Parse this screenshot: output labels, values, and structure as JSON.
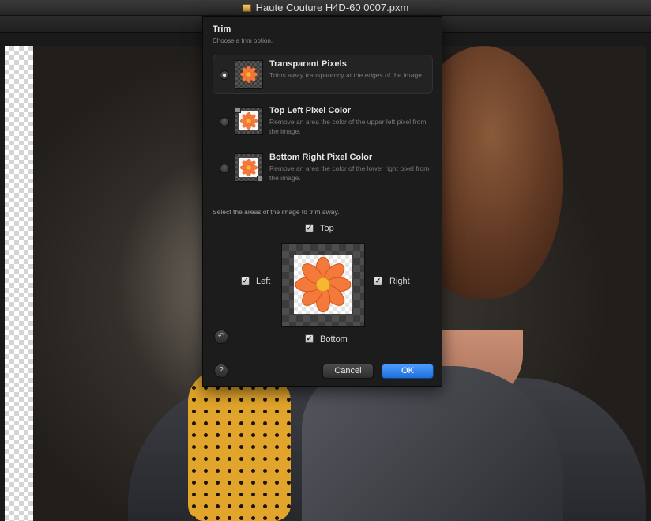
{
  "window": {
    "title": "Haute Couture H4D-60 0007.pxm"
  },
  "dialog": {
    "title": "Trim",
    "subtitle": "Choose a trim option.",
    "options": [
      {
        "title": "Transparent Pixels",
        "description": "Trims away transparency at the edges of the image.",
        "selected": true
      },
      {
        "title": "Top Left Pixel Color",
        "description": "Remove an area the color of the upper left pixel from the image.",
        "selected": false
      },
      {
        "title": "Bottom Right Pixel Color",
        "description": "Remove an area the color of the lower right pixel from the image.",
        "selected": false
      }
    ],
    "areas_label": "Select the areas of the image to trim away.",
    "areas": {
      "top": {
        "label": "Top",
        "checked": true
      },
      "left": {
        "label": "Left",
        "checked": true
      },
      "right": {
        "label": "Right",
        "checked": true
      },
      "bottom": {
        "label": "Bottom",
        "checked": true
      }
    },
    "help_label": "?",
    "reset_icon": "undo-arrow-icon",
    "cancel_label": "Cancel",
    "ok_label": "OK"
  },
  "colors": {
    "accent": "#2f86f0",
    "flower": "#f47a3c",
    "flower_center": "#f7b733"
  }
}
